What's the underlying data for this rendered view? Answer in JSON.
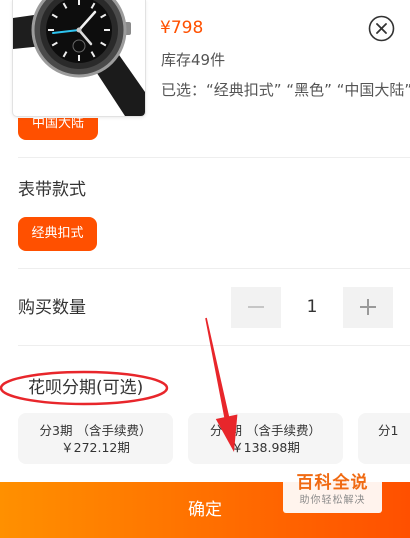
{
  "header": {
    "product_image": "watch-image",
    "price": "¥798",
    "stock": "库存49件",
    "selected": "已选：“经典扣式” “黑色” “中国大陆”",
    "close_icon": "close-icon"
  },
  "partial_option": {
    "label": "中国大陆",
    "selected": true
  },
  "strap_style": {
    "title": "表带款式",
    "options": [
      {
        "label": "经典扣式",
        "selected": true
      }
    ]
  },
  "quantity": {
    "title": "购买数量",
    "value": "1",
    "minus_icon": "minus-icon",
    "plus_icon": "plus-icon"
  },
  "installment": {
    "title": "花呗分期(可选)",
    "plans": [
      {
        "label": "分3期 （含手续费）",
        "amount": "￥272.12期"
      },
      {
        "label_start": "分",
        "label_end": "期 （含手续费）",
        "amount": "￥138.98期"
      },
      {
        "label": "分1"
      }
    ]
  },
  "confirm": {
    "label": "确定"
  },
  "watermark": {
    "title": "百科全说",
    "subtitle": "助你轻松解决"
  },
  "colors": {
    "accent": "#ff5000",
    "button_start": "#ff9000",
    "button_end": "#ff5000",
    "annotation_red": "#e8262b",
    "watermark_orange": "#f06a12",
    "card_bg": "#f5f5f5",
    "stepper_bg": "#f2f2f2",
    "divider": "#eeeeee",
    "text": "#333333",
    "muted": "#555555"
  }
}
